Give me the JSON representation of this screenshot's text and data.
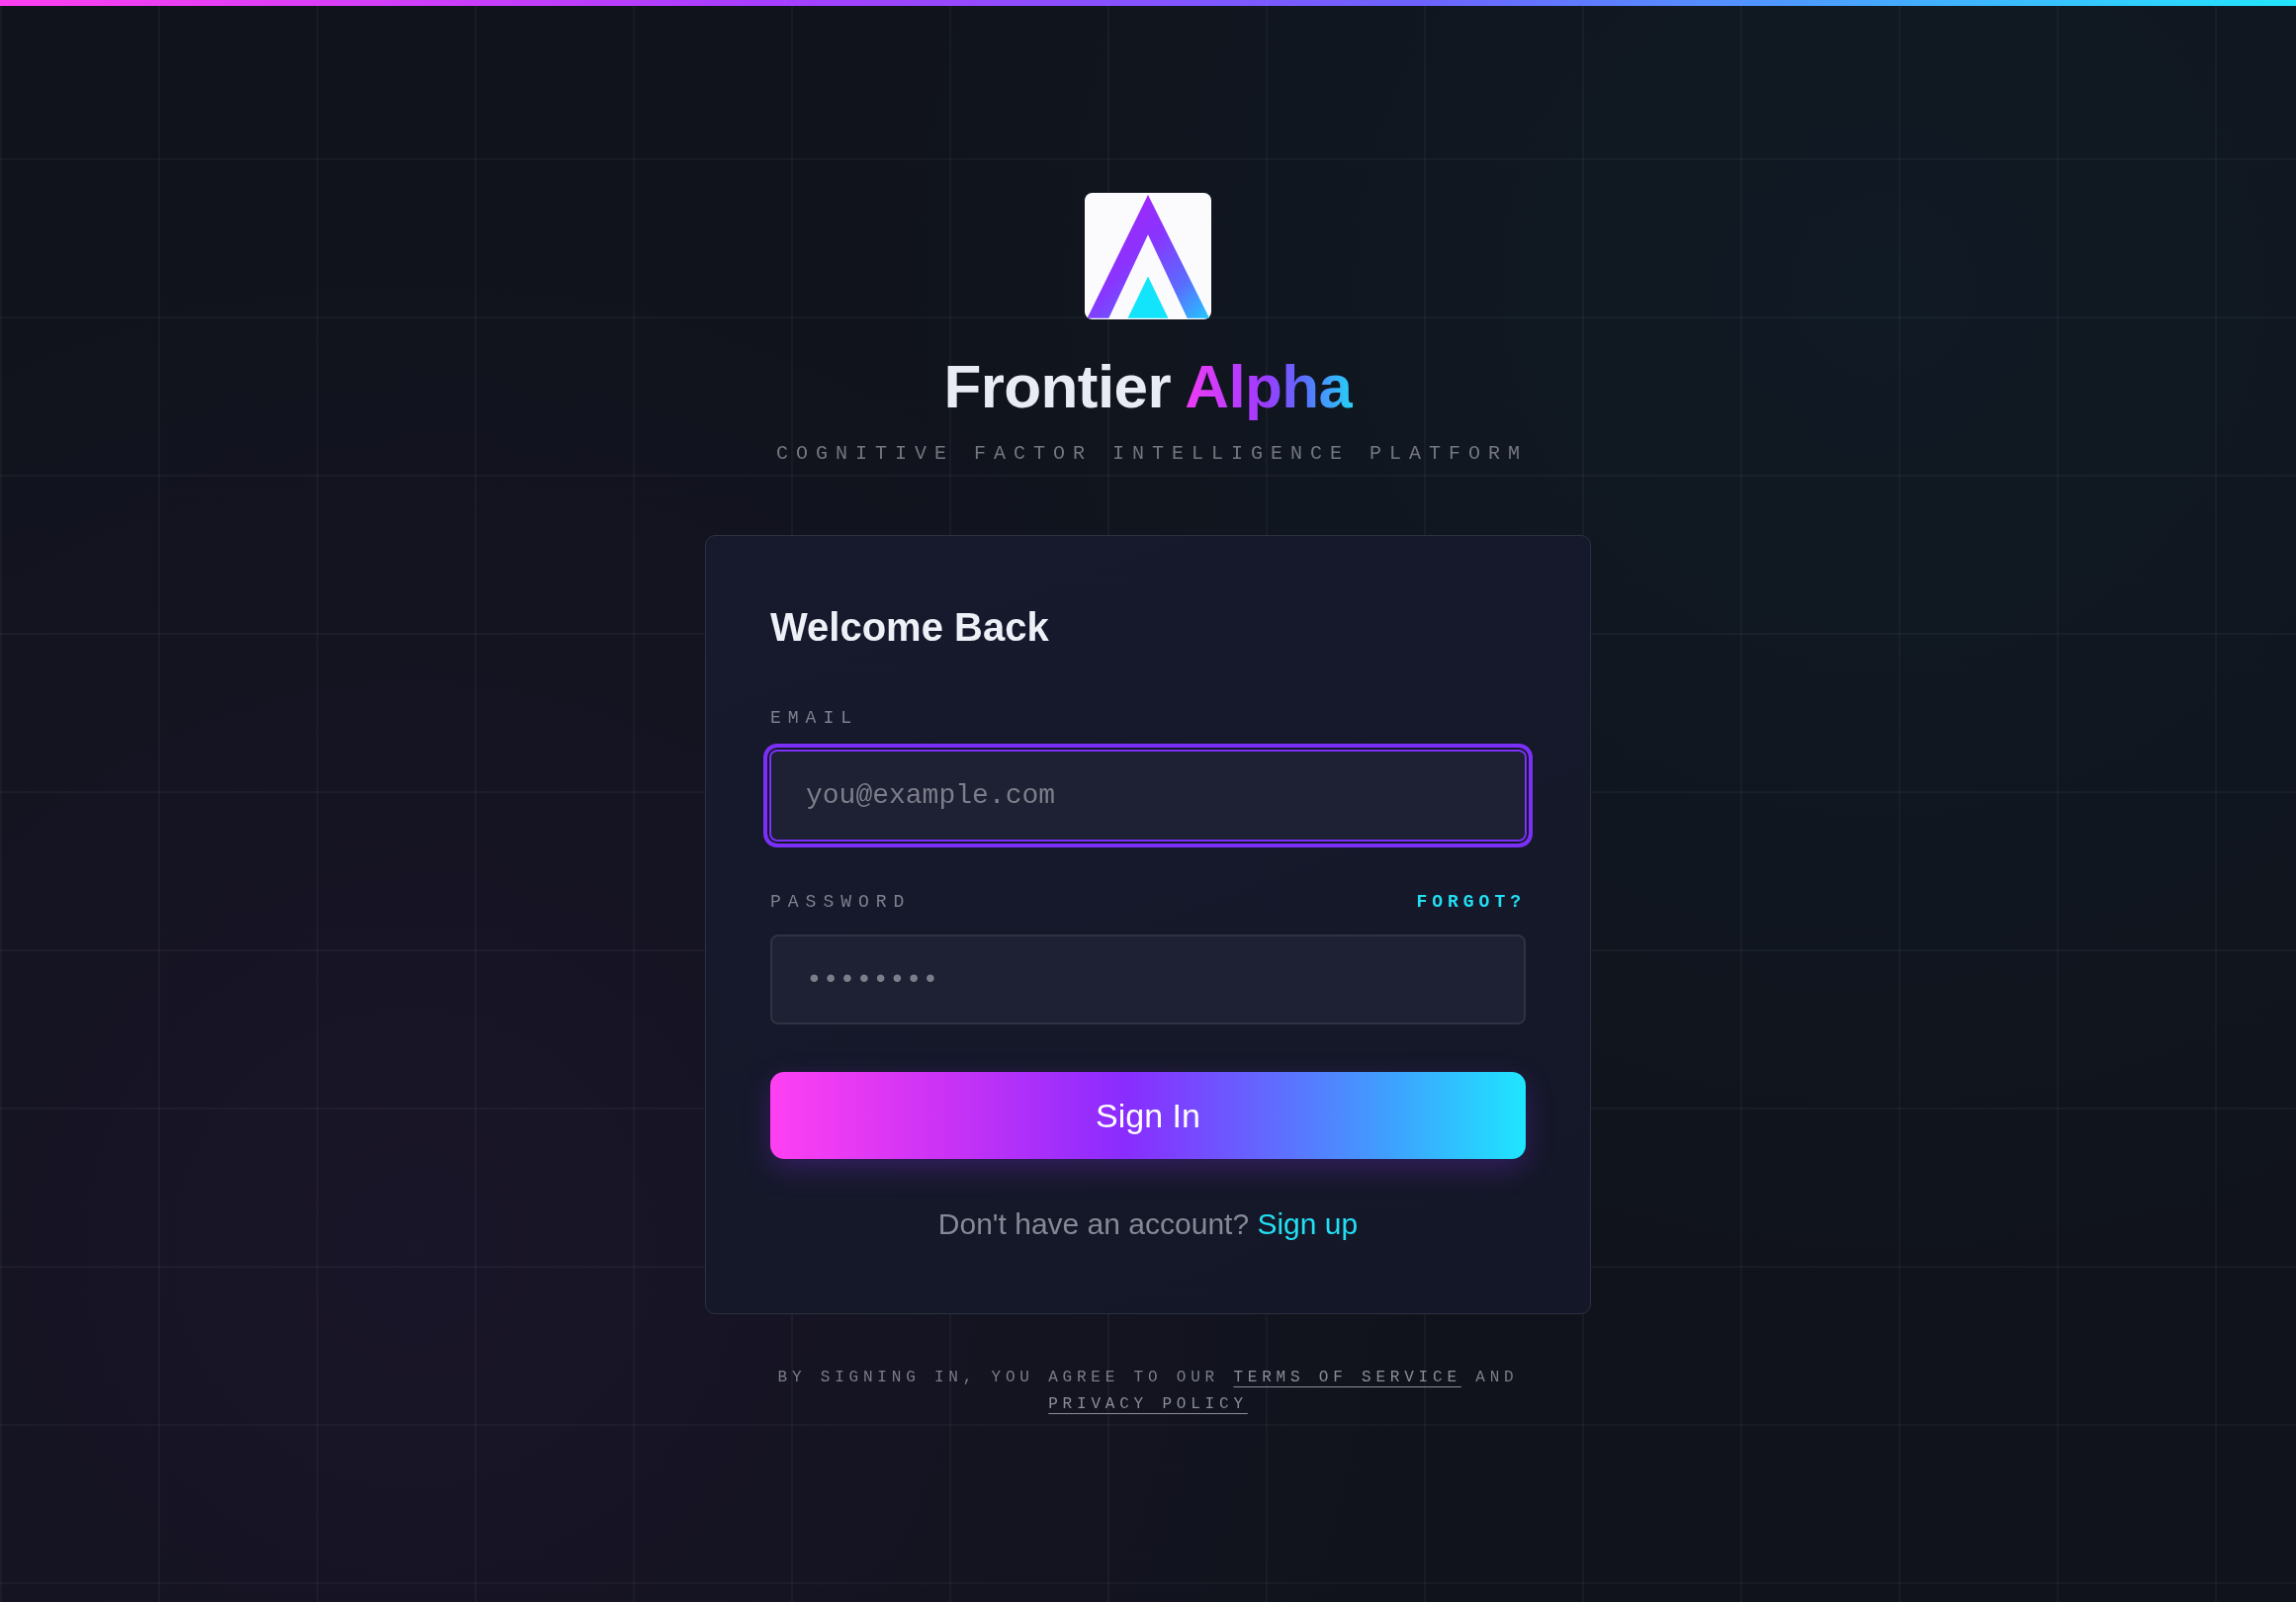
{
  "brand": {
    "name": "Frontier",
    "accent": "Alpha",
    "tagline": "COGNITIVE FACTOR INTELLIGENCE PLATFORM"
  },
  "card": {
    "title": "Welcome Back",
    "fields": [
      {
        "label": "EMAIL",
        "placeholder": "you@example.com",
        "focused": true
      },
      {
        "label": "PASSWORD",
        "placeholder": "••••••••",
        "focused": false,
        "link": "FORGOT?"
      }
    ],
    "submit": "Sign In",
    "signup": {
      "prompt": "Don't have an account?",
      "link": "Sign up"
    }
  },
  "legal": {
    "parts": [
      {
        "kind": "text",
        "text": "BY SIGNING IN, YOU AGREE TO OUR"
      },
      {
        "kind": "link",
        "text": "TERMS OF SERVICE"
      },
      {
        "kind": "text",
        "text": "AND"
      },
      {
        "kind": "link",
        "text": "PRIVACY POLICY"
      }
    ]
  }
}
